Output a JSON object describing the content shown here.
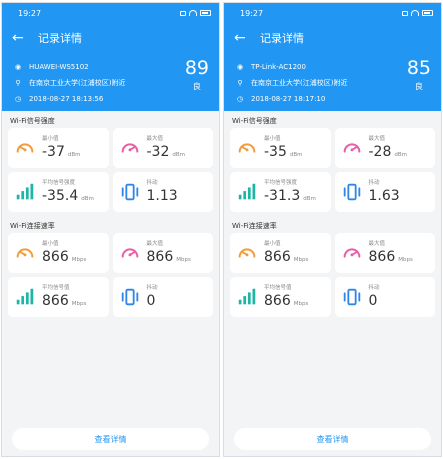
{
  "screens": [
    {
      "time": "19:27",
      "title": "记录详情",
      "ssid": "HUAWEI-WS5102",
      "location": "在南京工业大学(江浦校区)附近",
      "datetime": "2018-08-27 18:13:56",
      "score": "89",
      "grade": "良",
      "signal_section": "Wi-Fi信号强度",
      "signal": {
        "min": {
          "label": "最小值",
          "value": "-37",
          "unit": "dBm"
        },
        "max": {
          "label": "最大值",
          "value": "-32",
          "unit": "dBm"
        },
        "avg": {
          "label": "平均信号强度",
          "value": "-35.4",
          "unit": "dBm"
        },
        "jitter": {
          "label": "抖动",
          "value": "1.13"
        }
      },
      "rate_section": "Wi-Fi连接速率",
      "rate": {
        "min": {
          "label": "最小值",
          "value": "866",
          "unit": "Mbps"
        },
        "max": {
          "label": "最大值",
          "value": "866",
          "unit": "Mbps"
        },
        "avg": {
          "label": "平均信号值",
          "value": "866",
          "unit": "Mbps"
        },
        "jitter": {
          "label": "抖动",
          "value": "0"
        }
      },
      "button": "查看详情"
    },
    {
      "time": "19:27",
      "title": "记录详情",
      "ssid": "TP-Link-AC1200",
      "location": "在南京工业大学(江浦校区)附近",
      "datetime": "2018-08-27 18:17:10",
      "score": "85",
      "grade": "良",
      "signal_section": "Wi-Fi信号强度",
      "signal": {
        "min": {
          "label": "最小值",
          "value": "-35",
          "unit": "dBm"
        },
        "max": {
          "label": "最大值",
          "value": "-28",
          "unit": "dBm"
        },
        "avg": {
          "label": "平均信号强度",
          "value": "-31.3",
          "unit": "dBm"
        },
        "jitter": {
          "label": "抖动",
          "value": "1.63"
        }
      },
      "rate_section": "Wi-Fi连接速率",
      "rate": {
        "min": {
          "label": "最小值",
          "value": "866",
          "unit": "Mbps"
        },
        "max": {
          "label": "最大值",
          "value": "866",
          "unit": "Mbps"
        },
        "avg": {
          "label": "平均信号值",
          "value": "866",
          "unit": "Mbps"
        },
        "jitter": {
          "label": "抖动",
          "value": "0"
        }
      },
      "button": "查看详情"
    }
  ],
  "colors": {
    "primary": "#2196f3",
    "min_icon": "#f39c3d",
    "max_icon": "#e85fa8",
    "avg_icon": "#1fb5a4",
    "jitter_icon": "#2f86e8"
  },
  "icons": {
    "min": "gauge-min-icon",
    "max": "gauge-max-icon",
    "avg": "signal-bars-icon",
    "jitter": "phone-vibrate-icon"
  }
}
